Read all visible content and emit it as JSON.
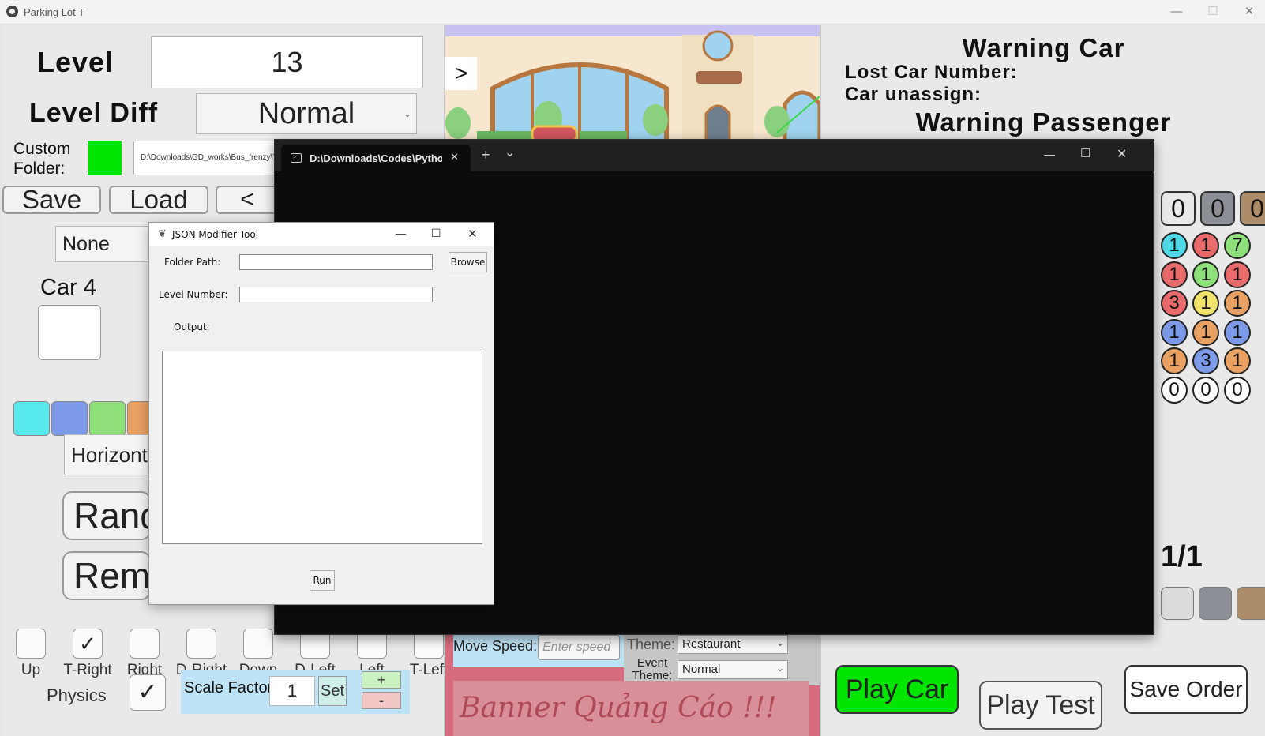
{
  "main_window": {
    "title": "Parking Lot T",
    "minimize": "—",
    "maximize": "☐",
    "close": "✕"
  },
  "left_panel": {
    "level_label": "Level",
    "level_value": "13",
    "level_diff_label": "Level Diff",
    "level_diff_value": "Normal",
    "custom_folder_label": "Custom Folder:",
    "custom_folder_path": "D:\\Downloads\\GD_works\\Bus_frenzy\\T",
    "save_label": "Save",
    "load_label": "Load",
    "prev_label": "<",
    "next_label": ">",
    "none_select": "None",
    "car_label": "Car 4",
    "orientation_select": "Horizontal",
    "random_button": "Random",
    "remove_button": "Remove",
    "directions": [
      {
        "label": "Up",
        "checked": false
      },
      {
        "label": "T-Right",
        "checked": true
      },
      {
        "label": "Right",
        "checked": false
      },
      {
        "label": "D-Right",
        "checked": false
      },
      {
        "label": "Down",
        "checked": false
      },
      {
        "label": "D-Left",
        "checked": false
      },
      {
        "label": "Left",
        "checked": false
      },
      {
        "label": "T-Left",
        "checked": false
      }
    ],
    "physics_label": "Physics",
    "physics_checked": true,
    "scale_factor_label": "Scale Factor:",
    "scale_factor_value": "1",
    "set_label": "Set",
    "plus_label": "+",
    "minus_label": "-",
    "swatch_colors": [
      "#58e9ee",
      "#7c9ae8",
      "#8fe07a",
      "#e9a063"
    ],
    "folder_indicator_color": "#00e600"
  },
  "center": {
    "move_speed_label": "Move Speed:",
    "move_speed_placeholder": "Enter speed",
    "theme_label": "Theme:",
    "theme_value": "Restaurant",
    "event_theme_label": "Event Theme:",
    "event_theme_value": "Normal",
    "banner_text": "Banner Quảng Cáo !!!"
  },
  "right_panel": {
    "warning_car_title": "Warning Car",
    "lost_car_label": "Lost Car Number:",
    "car_unassign_label": "Car unassign:",
    "warning_passenger_title": "Warning Passenger",
    "top_counts": [
      {
        "value": "0",
        "color": "#e9e9e9"
      },
      {
        "value": "0",
        "color": "#8c8f95"
      },
      {
        "value": "0",
        "color": "#ad8c6a"
      }
    ],
    "grid": [
      [
        {
          "v": "1",
          "c": "#4fd8e6"
        },
        {
          "v": "1",
          "c": "#e86a6a"
        },
        {
          "v": "7",
          "c": "#8ee07a"
        }
      ],
      [
        {
          "v": "1",
          "c": "#e86a6a"
        },
        {
          "v": "1",
          "c": "#8ee07a"
        },
        {
          "v": "1",
          "c": "#e86a6a"
        }
      ],
      [
        {
          "v": "3",
          "c": "#e86a6a"
        },
        {
          "v": "1",
          "c": "#f1e36a"
        },
        {
          "v": "1",
          "c": "#e9a063"
        }
      ],
      [
        {
          "v": "1",
          "c": "#7c9ae8"
        },
        {
          "v": "1",
          "c": "#e9a063"
        },
        {
          "v": "1",
          "c": "#7c9ae8"
        }
      ],
      [
        {
          "v": "1",
          "c": "#e9a063"
        },
        {
          "v": "3",
          "c": "#7c9ae8"
        },
        {
          "v": "1",
          "c": "#e9a063"
        }
      ],
      [
        {
          "v": "0",
          "c": "#ffffff"
        },
        {
          "v": "0",
          "c": "#ffffff"
        },
        {
          "v": "0",
          "c": "#ffffff"
        }
      ]
    ],
    "page_indicator": "1/1",
    "bottom_swatches": [
      "#dcdcdc",
      "#8c8f95",
      "#ad8c6a"
    ],
    "play_car_label": "Play Car",
    "play_car_color": "#00e600",
    "play_test_label": "Play Test",
    "save_order_label": "Save Order"
  },
  "terminal": {
    "tab_title": "D:\\Downloads\\Codes\\Python\\",
    "new_tab": "+",
    "dropdown": "⌄",
    "minimize": "—",
    "maximize": "☐",
    "close": "✕",
    "tab_close": "✕"
  },
  "json_tool": {
    "title": "JSON Modifier Tool",
    "folder_path_label": "Folder Path:",
    "browse_label": "Browse",
    "level_number_label": "Level Number:",
    "output_label": "Output:",
    "run_label": "Run",
    "minimize": "—",
    "maximize": "☐",
    "close": "✕"
  }
}
